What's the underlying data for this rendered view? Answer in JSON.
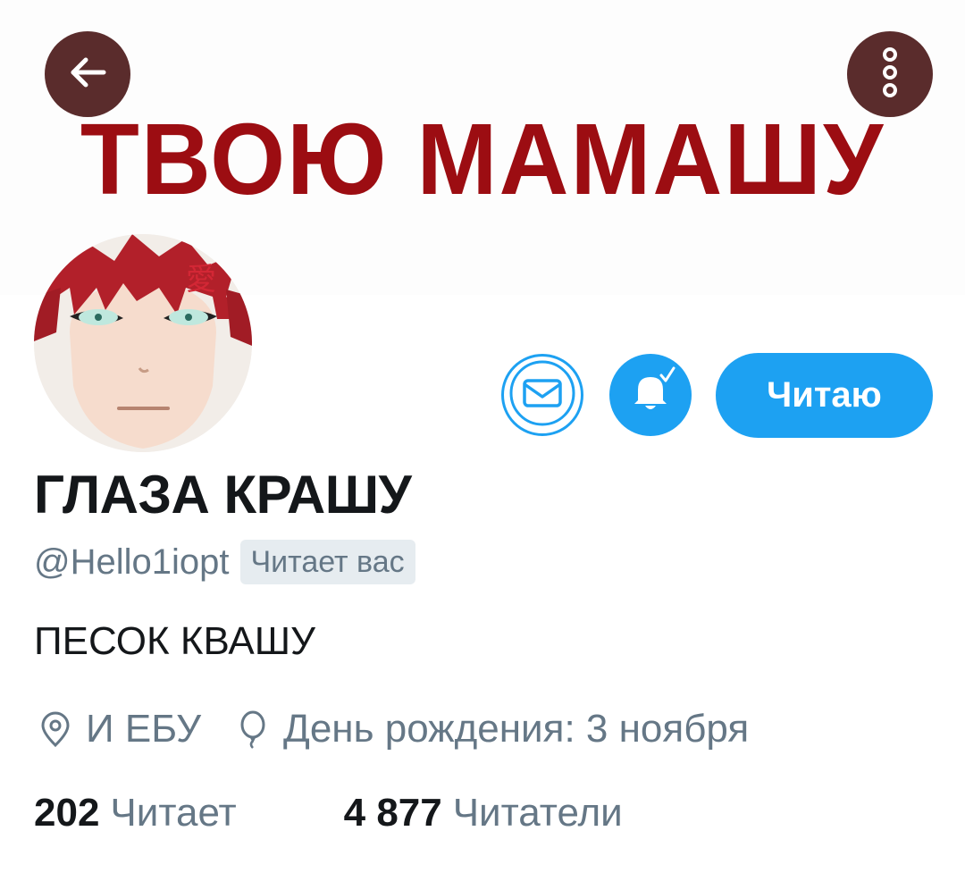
{
  "header": {
    "banner_text": "ТВОЮ МАМАШУ",
    "back_icon": "arrow-left-icon",
    "more_icon": "more-vertical-icon"
  },
  "actions": {
    "message_icon": "envelope-icon",
    "notify_icon": "bell-check-icon",
    "follow_label": "Читаю"
  },
  "profile": {
    "display_name": "ГЛАЗА КРАШУ",
    "handle": "@Hello1iopt",
    "follows_you_badge": "Читает вас",
    "bio": "ПЕСОК КВАШУ",
    "location": "И ЕБУ",
    "location_icon": "location-pin-icon",
    "birthday": "День рождения: 3 ноября",
    "birthday_icon": "balloon-icon"
  },
  "stats": {
    "following_count": "202",
    "following_label": "Читает",
    "followers_count": "4 877",
    "followers_label": "Читатели"
  },
  "colors": {
    "accent": "#1da1f2",
    "banner_text": "#9c0d12",
    "header_button_bg": "#5a2c2c",
    "secondary_text": "#657786",
    "primary_text": "#14171a"
  }
}
